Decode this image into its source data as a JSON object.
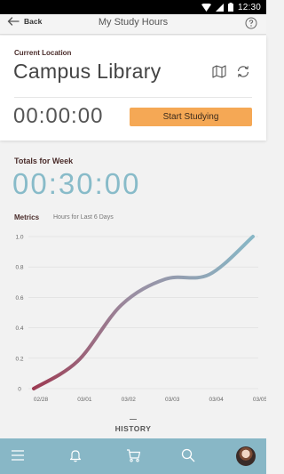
{
  "status_bar": {
    "time": "12:30"
  },
  "header": {
    "back_label": "Back",
    "title": "My Study Hours"
  },
  "location": {
    "caption": "Current Location",
    "name": "Campus Library"
  },
  "timer": {
    "value": "00:00:00",
    "start_label": "Start Studying"
  },
  "totals": {
    "caption": "Totals for Week",
    "value": "00:30:00"
  },
  "metrics": {
    "caption": "Metrics",
    "subtitle": "Hours for Last 6 Days"
  },
  "history": {
    "label": "HISTORY"
  },
  "chart_data": {
    "type": "line",
    "x": [
      "02/28",
      "03/01",
      "03/02",
      "03/03",
      "03/04",
      "03/05"
    ],
    "y_ticks": [
      "0",
      "0.2",
      "0.4",
      "0.6",
      "0.8",
      "1.0"
    ],
    "ylim": [
      0,
      1.0
    ],
    "series": [
      {
        "values": [
          0.0,
          0.18,
          0.55,
          0.72,
          0.75,
          1.0
        ]
      }
    ],
    "colors": {
      "start": "#9c3a52",
      "end": "#88b7c6"
    },
    "grid": true
  },
  "colors": {
    "accent": "#f5a855",
    "teal": "#88bbc9",
    "nav_bg": "#88b7c6"
  },
  "bottom_nav": {
    "items": [
      "menu-icon",
      "bell-icon",
      "cart-icon",
      "search-icon",
      "avatar"
    ]
  }
}
